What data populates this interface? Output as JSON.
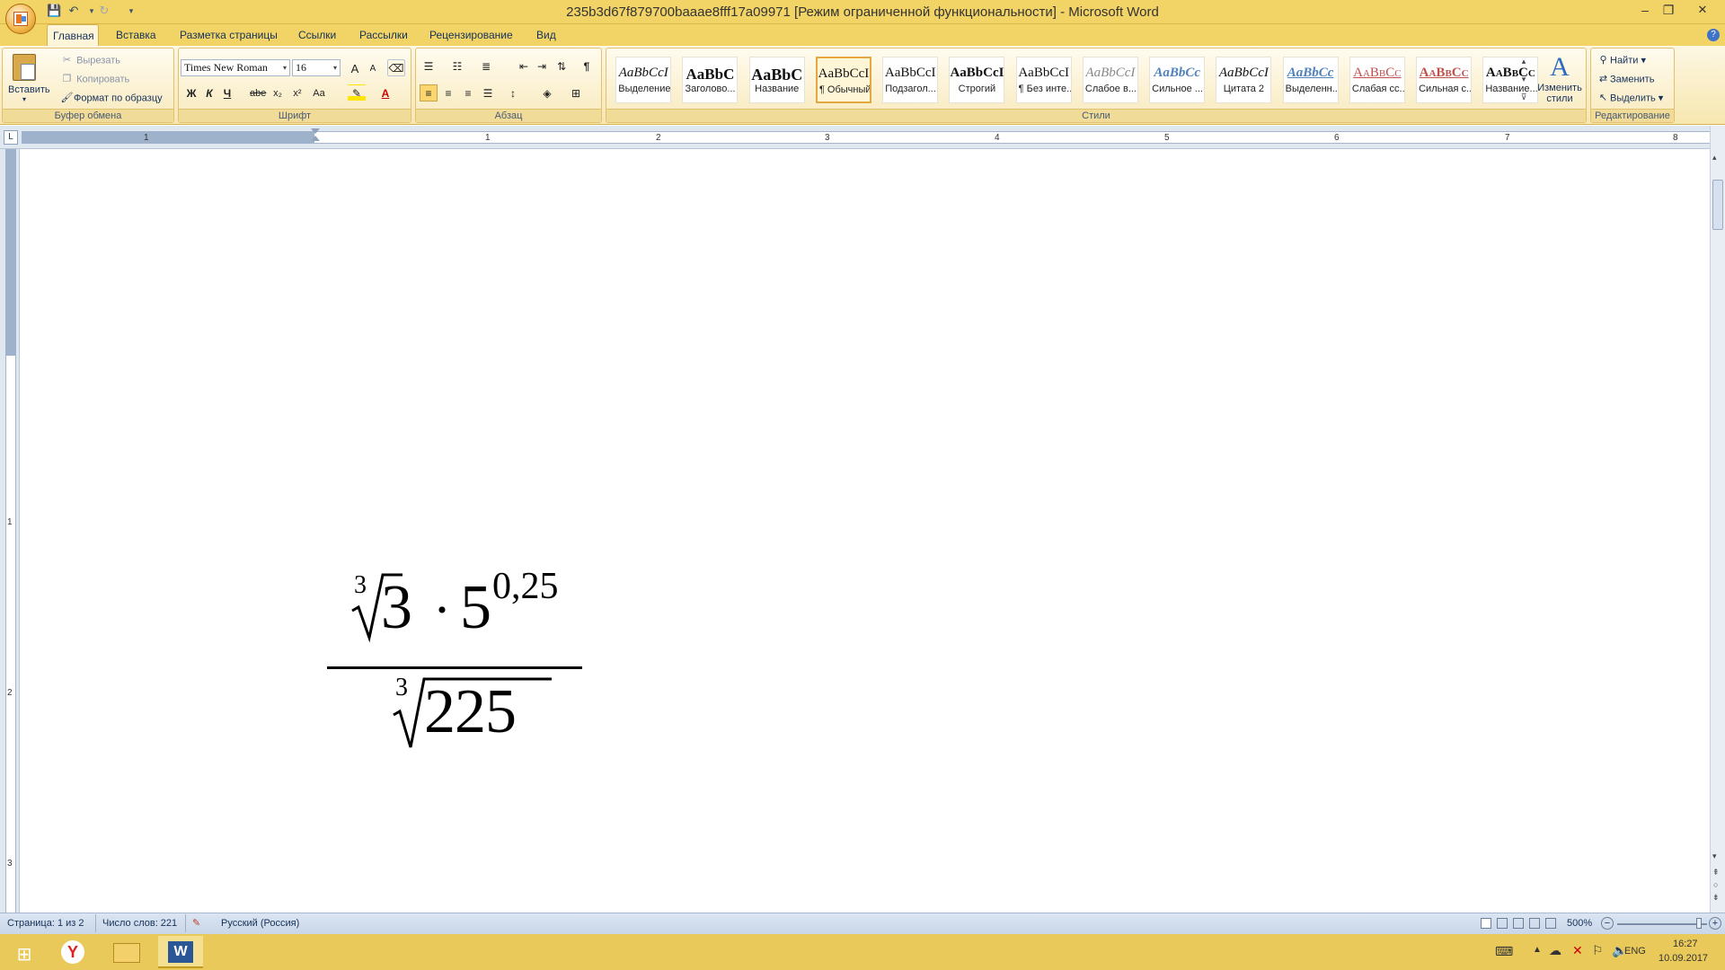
{
  "window": {
    "title": "235b3d67f879700baaae8fff17a09971 [Режим ограниченной функциональности] - Microsoft Word",
    "controls": [
      "–",
      "❐",
      "✕"
    ]
  },
  "tabs": [
    "Главная",
    "Вставка",
    "Разметка страницы",
    "Ссылки",
    "Рассылки",
    "Рецензирование",
    "Вид"
  ],
  "clipboard": {
    "paste": "Вставить",
    "cut": "Вырезать",
    "copy": "Копировать",
    "format_painter": "Формат по образцу",
    "label": "Буфер обмена"
  },
  "font": {
    "name": "Times New Roman",
    "size": "16",
    "label": "Шрифт",
    "bold": "Ж",
    "italic": "К",
    "underline": "Ч",
    "strike": "abe",
    "subscript": "x₂",
    "superscript": "x²",
    "case": "Aa",
    "grow": "A",
    "shrink": "A"
  },
  "paragraph": {
    "label": "Абзац"
  },
  "styles": {
    "label": "Стили",
    "items": [
      {
        "sample": "AaBbCcI",
        "name": "Выделение"
      },
      {
        "sample": "AaBbC",
        "name": "Заголово..."
      },
      {
        "sample": "AaBbC",
        "name": "Название"
      },
      {
        "sample": "AaBbCcI",
        "name": "¶ Обычный"
      },
      {
        "sample": "AaBbCcI",
        "name": "Подзагол..."
      },
      {
        "sample": "AaBbCcI",
        "name": "Строгий"
      },
      {
        "sample": "AaBbCcI",
        "name": "¶ Без инте..."
      },
      {
        "sample": "AaBbCcI",
        "name": "Слабое в..."
      },
      {
        "sample": "AaBbCc",
        "name": "Сильное ..."
      },
      {
        "sample": "AaBbCcI",
        "name": "Цитата 2"
      },
      {
        "sample": "AaBbCc",
        "name": "Выделенн..."
      },
      {
        "sample": "AaBbCc",
        "name": "Слабая сс..."
      },
      {
        "sample": "AaBbCc",
        "name": "Сильная с..."
      },
      {
        "sample": "AaBbCc",
        "name": "Название..."
      }
    ],
    "change_styles": "Изменить стили"
  },
  "editing": {
    "find": "Найти",
    "replace": "Заменить",
    "select": "Выделить",
    "label": "Редактирование"
  },
  "ruler": {
    "h_numbers": [
      "1",
      "1",
      "2",
      "3",
      "4",
      "5",
      "6",
      "7",
      "8"
    ],
    "v_numbers": [
      "1",
      "2",
      "3"
    ]
  },
  "equation": {
    "num_root_index": "3",
    "num_radicand": "3",
    "dot": "·",
    "base": "5",
    "exponent": "0,25",
    "den_root_index": "3",
    "den_radicand": "225"
  },
  "status": {
    "page": "Страница: 1 из 2",
    "words": "Число слов: 221",
    "language": "Русский (Россия)",
    "zoom": "500%"
  },
  "taskbar": {
    "lang": "ENG",
    "time": "16:27",
    "date": "10.09.2017"
  }
}
